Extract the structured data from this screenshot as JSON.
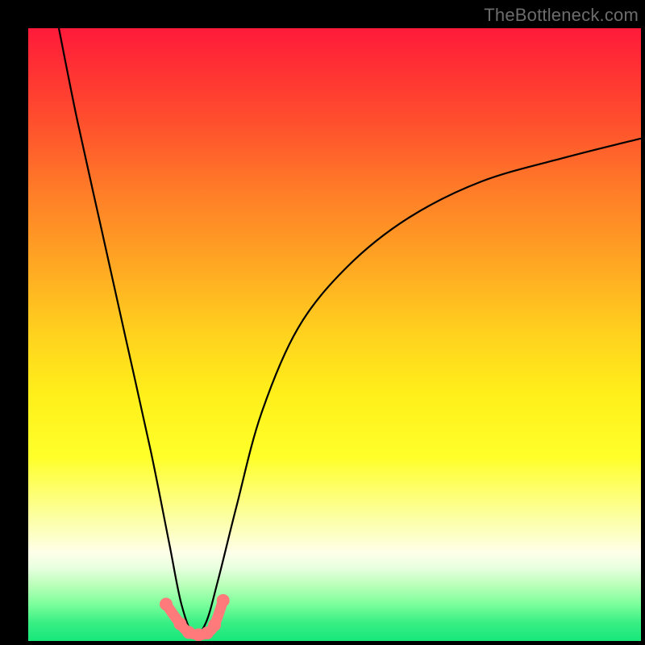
{
  "watermark": {
    "text": "TheBottleneck.com"
  },
  "colors": {
    "frame": "#000000",
    "curve": "#000000",
    "marker_fill": "#ff7b7b",
    "marker_stroke": "#e85a5a"
  },
  "chart_data": {
    "type": "line",
    "title": "",
    "xlabel": "",
    "ylabel": "",
    "xlim": [
      0,
      100
    ],
    "ylim": [
      0,
      100
    ],
    "note": "Values estimated from pixels; vertical axis shows bottleneck % (0 at bottom/green, 100 at top/red). Minimum of curve near x≈27.",
    "series": [
      {
        "name": "bottleneck-curve",
        "x": [
          5,
          8,
          12,
          16,
          20,
          23,
          25,
          27,
          29,
          31,
          34,
          38,
          44,
          52,
          62,
          74,
          88,
          100
        ],
        "y": [
          100,
          85,
          67,
          49,
          31,
          16,
          6,
          1,
          3,
          10,
          22,
          37,
          51,
          61,
          69,
          75,
          79,
          82
        ]
      }
    ],
    "markers": {
      "name": "near-optimal-points",
      "x": [
        22.5,
        24.8,
        26.2,
        27.8,
        29.2,
        30.4,
        31.8
      ],
      "y": [
        6.0,
        2.8,
        1.4,
        1.0,
        1.3,
        2.6,
        6.6
      ]
    },
    "background_gradient": {
      "direction": "vertical",
      "stops": [
        {
          "pos": 0.0,
          "color": "#ff1a3a"
        },
        {
          "pos": 0.5,
          "color": "#ffd21e"
        },
        {
          "pos": 0.82,
          "color": "#fcffb0"
        },
        {
          "pos": 1.0,
          "color": "#17e77a"
        }
      ]
    }
  }
}
